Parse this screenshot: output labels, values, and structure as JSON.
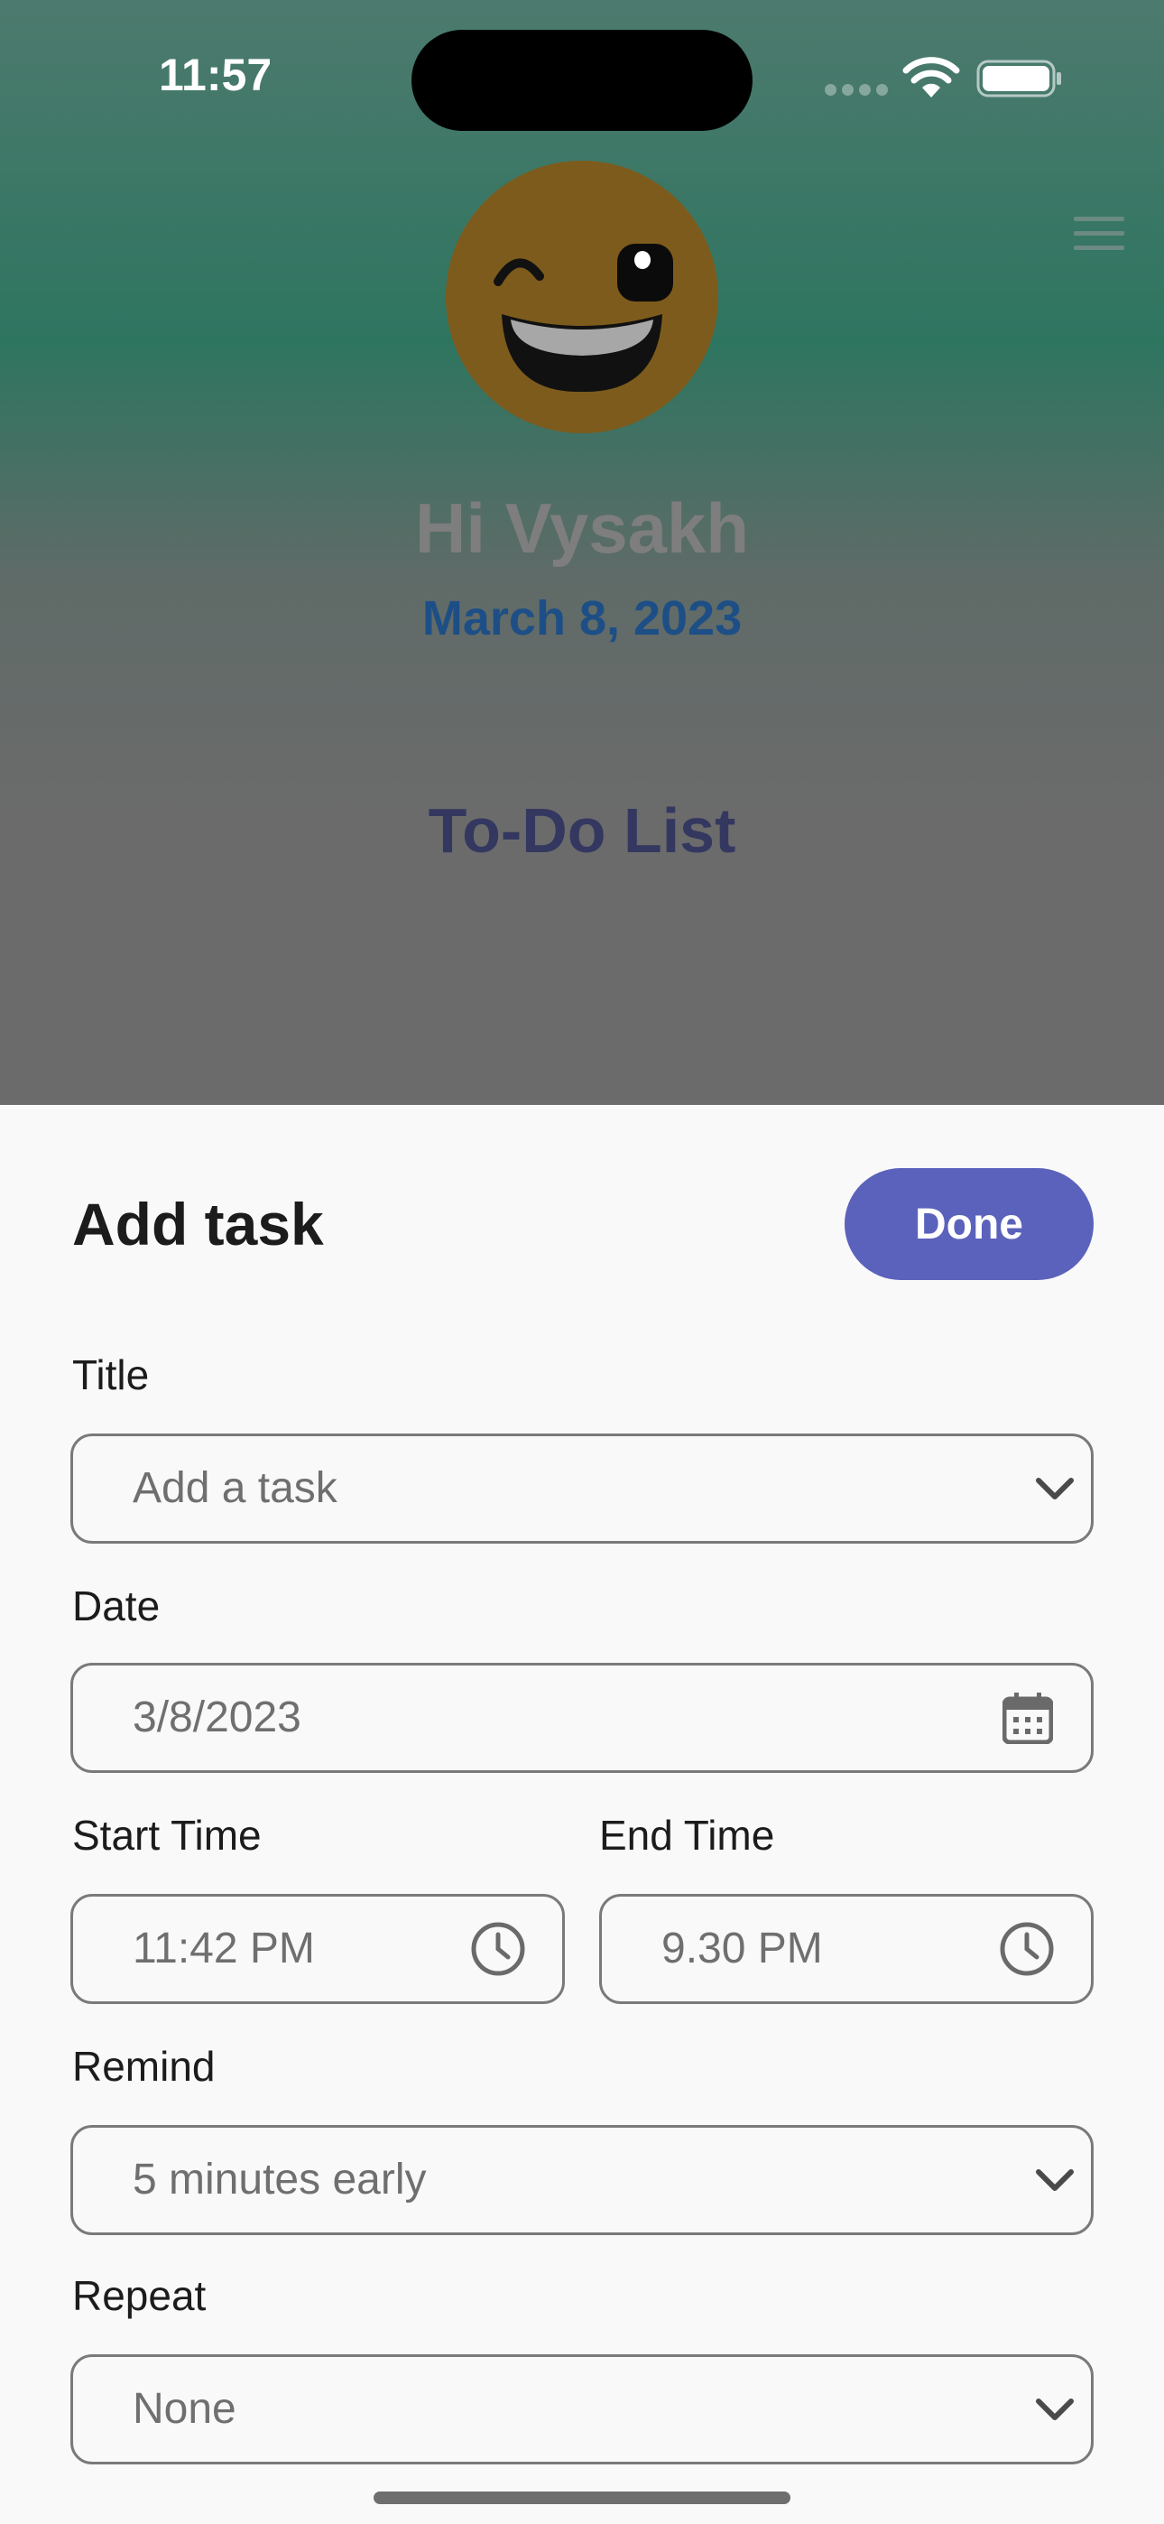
{
  "status_bar": {
    "time": "11:57"
  },
  "header": {
    "greeting": "Hi Vysakh",
    "date": "March 8, 2023",
    "list_title": "To-Do List",
    "avatar_icon": "winking-emoji-icon",
    "menu_icon": "hamburger-menu-icon"
  },
  "sheet": {
    "title": "Add task",
    "done_label": "Done",
    "fields": {
      "title": {
        "label": "Title",
        "placeholder": "Add a task",
        "icon": "chevron-down-icon"
      },
      "date": {
        "label": "Date",
        "value": "3/8/2023",
        "icon": "calendar-icon"
      },
      "start_time": {
        "label": "Start Time",
        "value": "11:42 PM",
        "icon": "clock-icon"
      },
      "end_time": {
        "label": "End Time",
        "value": "9.30 PM",
        "icon": "clock-icon"
      },
      "remind": {
        "label": "Remind",
        "value": "5 minutes early",
        "icon": "chevron-down-icon"
      },
      "repeat": {
        "label": "Repeat",
        "value": "None",
        "icon": "chevron-down-icon"
      }
    }
  },
  "colors": {
    "accent": "#5b62bb",
    "date_text": "#1d4f86",
    "list_title": "#343860",
    "greeting": "#7e7e7e"
  }
}
